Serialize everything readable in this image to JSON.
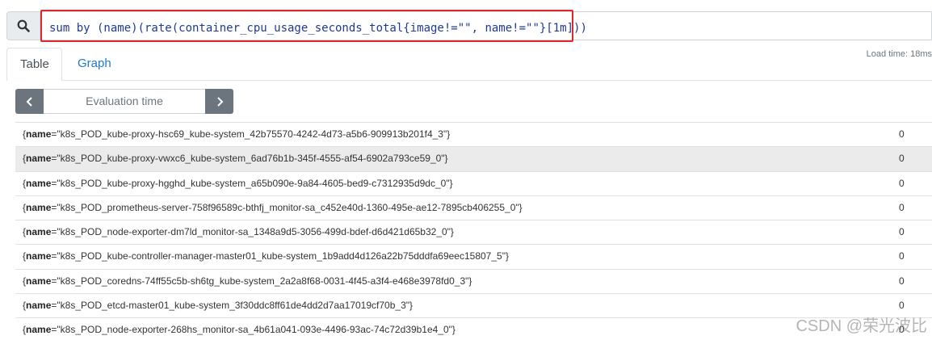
{
  "query": {
    "expression": "sum by (name)(rate(container_cpu_usage_seconds_total{image!=\"\", name!=\"\"}[1m]))",
    "highlighted": true
  },
  "tabs": [
    {
      "label": "Table",
      "active": true
    },
    {
      "label": "Graph",
      "active": false
    }
  ],
  "load_time": "Load time: 18ms",
  "evaluation": {
    "placeholder": "Evaluation time",
    "prev_icon": "chevron-left-icon",
    "next_icon": "chevron-right-icon"
  },
  "results": [
    {
      "label_key": "name",
      "label_value": "k8s_POD_kube-proxy-hsc69_kube-system_42b75570-4242-4d73-a5b6-909913b201f4_3",
      "value": "0"
    },
    {
      "label_key": "name",
      "label_value": "k8s_POD_kube-proxy-vwxc6_kube-system_6ad76b1b-345f-4555-af54-6902a793ce59_0",
      "value": "0"
    },
    {
      "label_key": "name",
      "label_value": "k8s_POD_kube-proxy-hgghd_kube-system_a65b090e-9a84-4605-bed9-c7312935d9dc_0",
      "value": "0"
    },
    {
      "label_key": "name",
      "label_value": "k8s_POD_prometheus-server-758f96589c-bthfj_monitor-sa_c452e40d-1360-495e-ae12-7895cb406255_0",
      "value": "0"
    },
    {
      "label_key": "name",
      "label_value": "k8s_POD_node-exporter-dm7ld_monitor-sa_1348a9d5-3056-499d-bdef-d6d421d65b32_0",
      "value": "0"
    },
    {
      "label_key": "name",
      "label_value": "k8s_POD_kube-controller-manager-master01_kube-system_1b9add4d126a22b75dddfa69eec15807_5",
      "value": "0"
    },
    {
      "label_key": "name",
      "label_value": "k8s_POD_coredns-74ff55c5b-sh6tg_kube-system_2a2a8f68-0031-4f45-a3f4-e468e3978fd0_3",
      "value": "0"
    },
    {
      "label_key": "name",
      "label_value": "k8s_POD_etcd-master01_kube-system_3f30ddc8ff61de4dd2d7aa17019cf70b_3",
      "value": "0"
    },
    {
      "label_key": "name",
      "label_value": "k8s_POD_node-exporter-268hs_monitor-sa_4b61a041-093e-4496-93ac-74c72d39b1e4_0",
      "value": "0"
    }
  ],
  "watermark": "CSDN @荣光波比"
}
